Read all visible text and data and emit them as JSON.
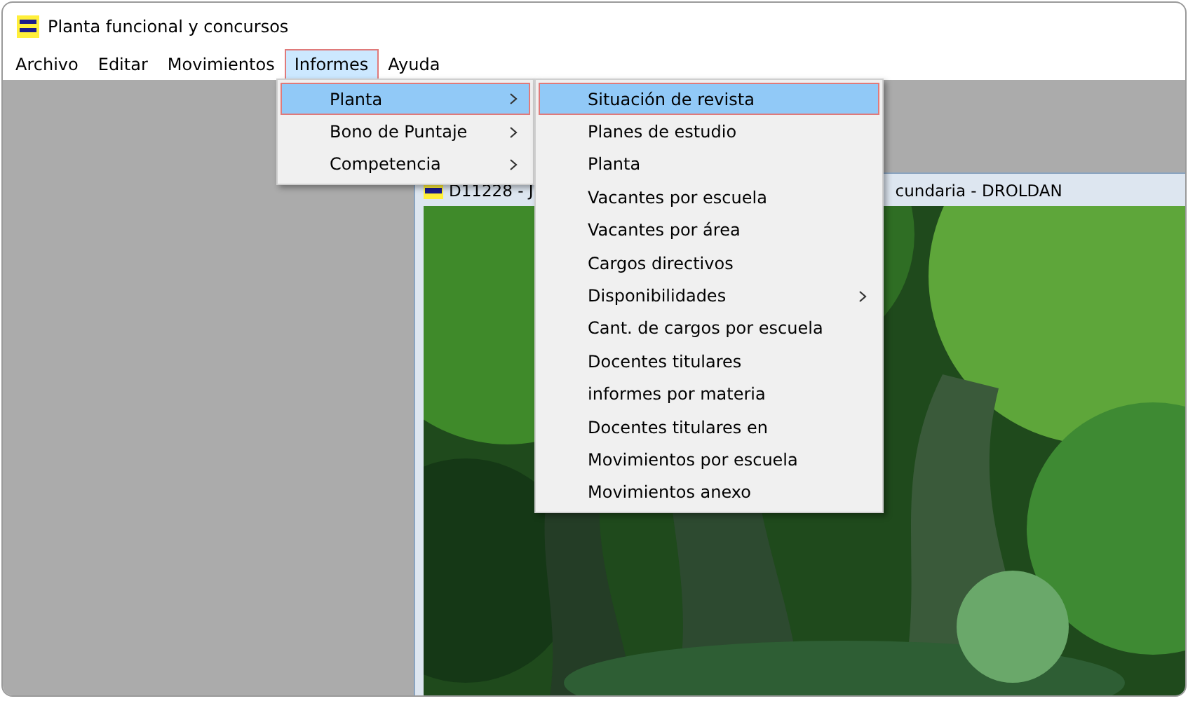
{
  "window": {
    "title": "Planta funcional y concursos"
  },
  "menu_bar": [
    {
      "label": "Archivo",
      "selected": false
    },
    {
      "label": "Editar",
      "selected": false
    },
    {
      "label": "Movimientos",
      "selected": false
    },
    {
      "label": "Informes",
      "selected": true
    },
    {
      "label": "Ayuda",
      "selected": false
    }
  ],
  "dropdown": [
    {
      "label": "Planta",
      "selected": true,
      "submenu": true
    },
    {
      "label": "Bono de Puntaje",
      "selected": false,
      "submenu": true
    },
    {
      "label": "Competencia",
      "selected": false,
      "submenu": true
    }
  ],
  "submenu": [
    {
      "label": "Situación de revista",
      "selected": true,
      "submenu": false
    },
    {
      "label": "Planes de estudio",
      "selected": false,
      "submenu": false
    },
    {
      "label": "Planta",
      "selected": false,
      "submenu": false
    },
    {
      "label": "Vacantes por escuela",
      "selected": false,
      "submenu": false
    },
    {
      "label": "Vacantes por área",
      "selected": false,
      "submenu": false
    },
    {
      "label": "Cargos directivos",
      "selected": false,
      "submenu": false
    },
    {
      "label": "Disponibilidades",
      "selected": false,
      "submenu": true
    },
    {
      "label": "Cant. de cargos por escuela",
      "selected": false,
      "submenu": false
    },
    {
      "label": "Docentes titulares",
      "selected": false,
      "submenu": false
    },
    {
      "label": "informes por materia",
      "selected": false,
      "submenu": false
    },
    {
      "label": "Docentes titulares en",
      "selected": false,
      "submenu": false
    },
    {
      "label": "Movimientos por escuela",
      "selected": false,
      "submenu": false
    },
    {
      "label": "Movimientos anexo",
      "selected": false,
      "submenu": false
    }
  ],
  "child_window": {
    "title_start": "D11228 - J",
    "title_end": "cundaria - DROLDAN"
  }
}
